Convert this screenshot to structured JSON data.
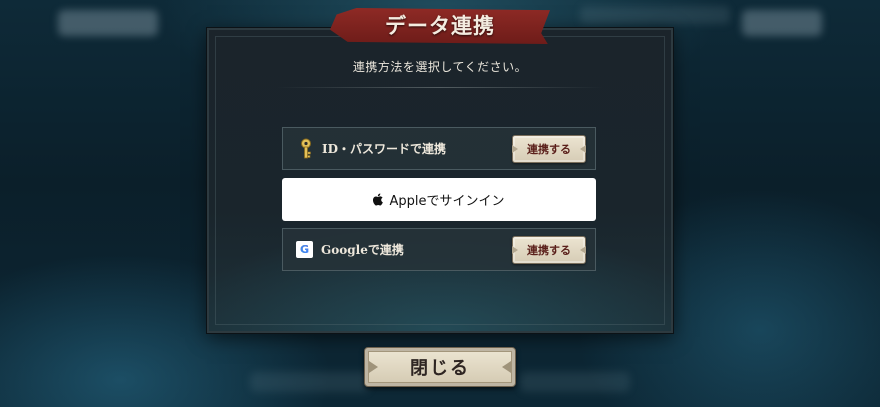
{
  "dialog": {
    "title": "データ連携",
    "instruction": "連携方法を選択してください。"
  },
  "options": {
    "id_password": {
      "label": "ID・パスワードで連携",
      "button_label": "連携する",
      "icon": "key-icon"
    },
    "apple": {
      "label": "Appleでサインイン",
      "icon": "apple-icon"
    },
    "google": {
      "label": "Googleで連携",
      "button_label": "連携する",
      "icon": "google-icon",
      "icon_glyph": "G"
    }
  },
  "footer": {
    "close_label": "閉じる"
  },
  "colors": {
    "ribbon": "#8e2a25",
    "button_face": "#ece4d1",
    "button_text": "#5a1f1a",
    "dialog_bg": "#1b242b"
  }
}
